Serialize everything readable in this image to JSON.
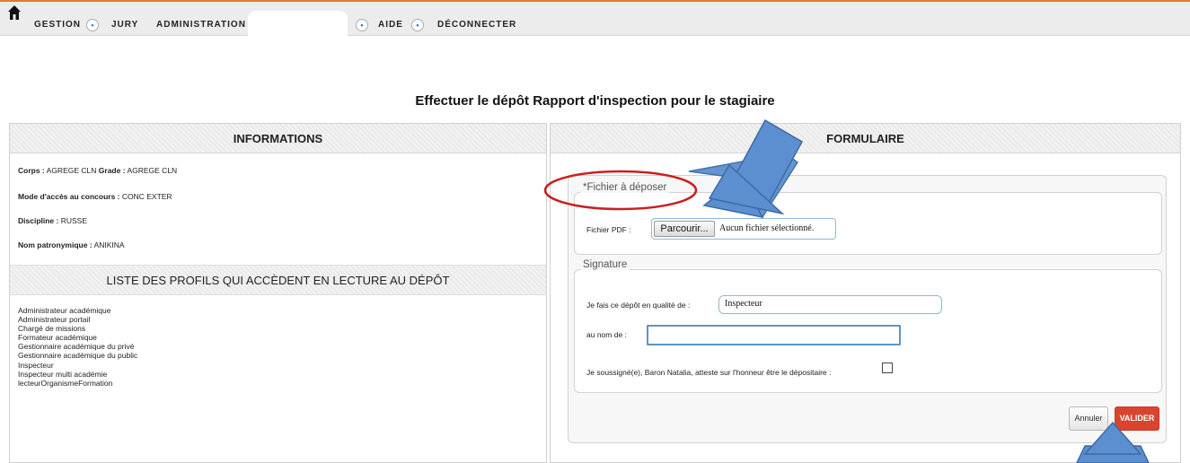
{
  "nav": {
    "home_icon": "home-icon",
    "items": [
      "GESTION",
      "JURY",
      "ADMINISTRATION",
      "AIDE",
      "DÉCONNECTER"
    ],
    "circle_glyph": "•",
    "accent": "#e07c2c"
  },
  "page": {
    "title": "Effectuer le dépôt Rapport d'inspection pour le stagiaire"
  },
  "informations": {
    "header": "INFORMATIONS",
    "corps_label": "Corps :",
    "corps_value": "AGREGE CLN",
    "grade_label": "Grade :",
    "grade_value": "AGREGE CLN",
    "mode_label": "Mode d'accès au concours :",
    "mode_value": "CONC EXTER",
    "discipline_label": "Discipline :",
    "discipline_value": "RUSSE",
    "nom_label": "Nom patronymique :",
    "nom_value": "ANIKINA"
  },
  "profiles": {
    "header": "LISTE DES PROFILS QUI ACCÈDENT EN LECTURE AU DÉPÔT",
    "items": [
      "Administrateur académique",
      "Administrateur portail",
      "Chargé de missions",
      "Formateur académique",
      "Gestionnaire académique du privé",
      "Gestionnaire académique du public",
      "Inspecteur",
      "Inspecteur multi académie",
      "lecteurOrganismeFormation"
    ]
  },
  "form": {
    "header": "FORMULAIRE",
    "file_legend": "*Fichier à déposer",
    "file_label": "Fichier PDF :",
    "file_button": "Parcourir...",
    "file_status": "Aucun fichier sélectionné.",
    "signature_legend": "Signature",
    "quality_label": "Je fais ce dépôt en qualité de :",
    "quality_value": "Inspecteur",
    "name_label": "au nom de :",
    "name_value": "",
    "attest_label": "Je soussigné(e), Baron Natalia, atteste sur l'honneur être le dépositaire :",
    "attest_checked": false,
    "cancel_label": "Annuler",
    "submit_label": "VALIDER",
    "submit_color": "#d8442f"
  },
  "annotations": {
    "arrow_color": "#5b8fcf",
    "circle_color": "#cc1f1f"
  }
}
